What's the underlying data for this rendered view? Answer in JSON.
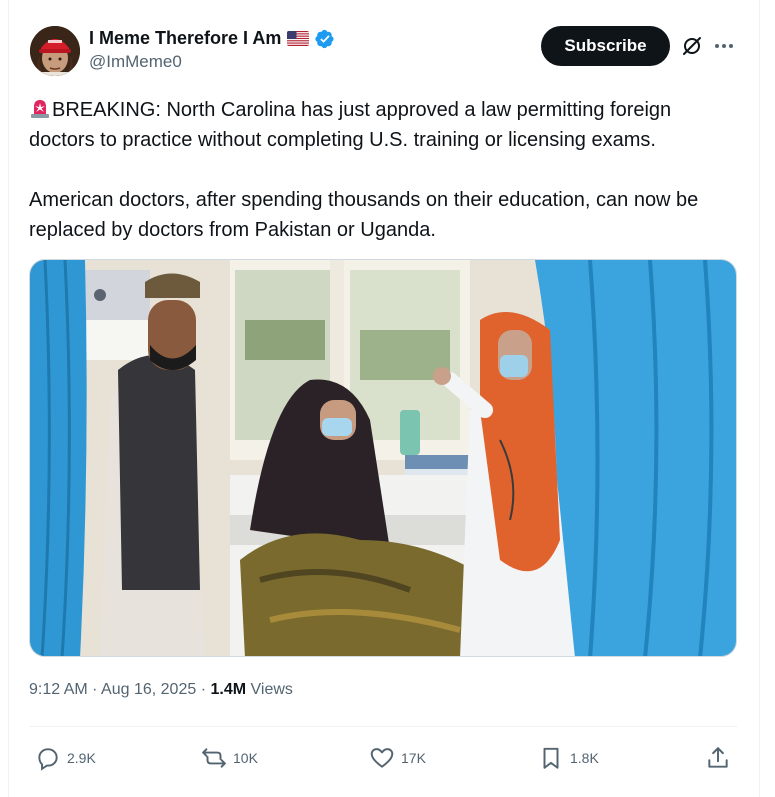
{
  "author": {
    "display_name": "I Meme Therefore I Am",
    "handle": "@ImMeme0",
    "verified": true,
    "flag": "us-flag-emoji",
    "avatar": "avatar-man-red-cap"
  },
  "header": {
    "subscribe_label": "Subscribe",
    "icons": [
      "grok-icon",
      "more-icon"
    ]
  },
  "tweet": {
    "paragraphs": [
      "BREAKING: North Carolina has just approved a law permitting foreign doctors to practice without completing U.S. training or licensing exams.",
      "American doctors, after spending thousands on their education, can now be replaced by doctors from Pakistan or Uganda."
    ],
    "lead_icon": "rotating-light-icon",
    "media": "photo-hospital-ward-doctor-with-patient"
  },
  "meta": {
    "time": "9:12 AM",
    "separator": "·",
    "date": "Aug 16, 2025",
    "views_count": "1.4M",
    "views_label": "Views"
  },
  "actions": {
    "replies": "2.9K",
    "reposts": "10K",
    "likes": "17K",
    "bookmarks": "1.8K"
  },
  "colors": {
    "text_primary": "#0f1419",
    "text_secondary": "#536471",
    "verified_blue": "#1d9bf0",
    "subscribe_bg": "#0f1419",
    "divider": "#eff3f4"
  }
}
